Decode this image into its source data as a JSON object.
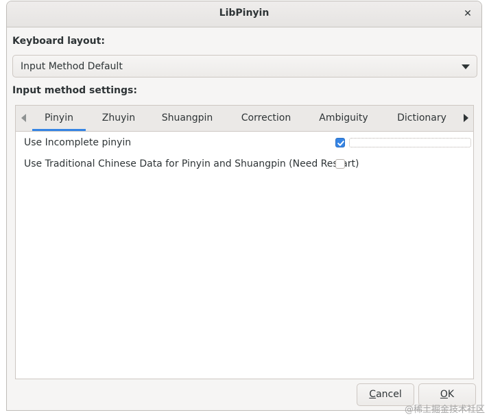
{
  "window": {
    "title": "LibPinyin",
    "close_glyph": "✕"
  },
  "keyboard_layout": {
    "label": "Keyboard layout:",
    "selected": "Input Method Default"
  },
  "settings": {
    "label": "Input method settings:"
  },
  "tabs": [
    {
      "label": "Pinyin",
      "active": true
    },
    {
      "label": "Zhuyin",
      "active": false
    },
    {
      "label": "Shuangpin",
      "active": false
    },
    {
      "label": "Correction",
      "active": false
    },
    {
      "label": "Ambiguity",
      "active": false
    },
    {
      "label": "Dictionary",
      "active": false
    }
  ],
  "pinyin_page": {
    "options": [
      {
        "label": "Use Incomplete pinyin",
        "checked": true
      },
      {
        "label": "Use Traditional Chinese Data for Pinyin and Shuangpin (Need Restart)",
        "checked": false
      }
    ]
  },
  "buttons": {
    "cancel_mnemonic": "C",
    "cancel_rest": "ancel",
    "ok_mnemonic": "O",
    "ok_rest": "K"
  },
  "watermark": "@稀土掘金技术社区",
  "icons": {
    "close": "close-icon",
    "combo": "chevron-down-icon",
    "tab_left": "chevron-left-icon",
    "tab_right": "chevron-right-icon",
    "check": "checkmark-icon"
  },
  "colors": {
    "accent": "#3584e4",
    "text": "#2e3436",
    "window_bg": "#f6f5f4"
  }
}
